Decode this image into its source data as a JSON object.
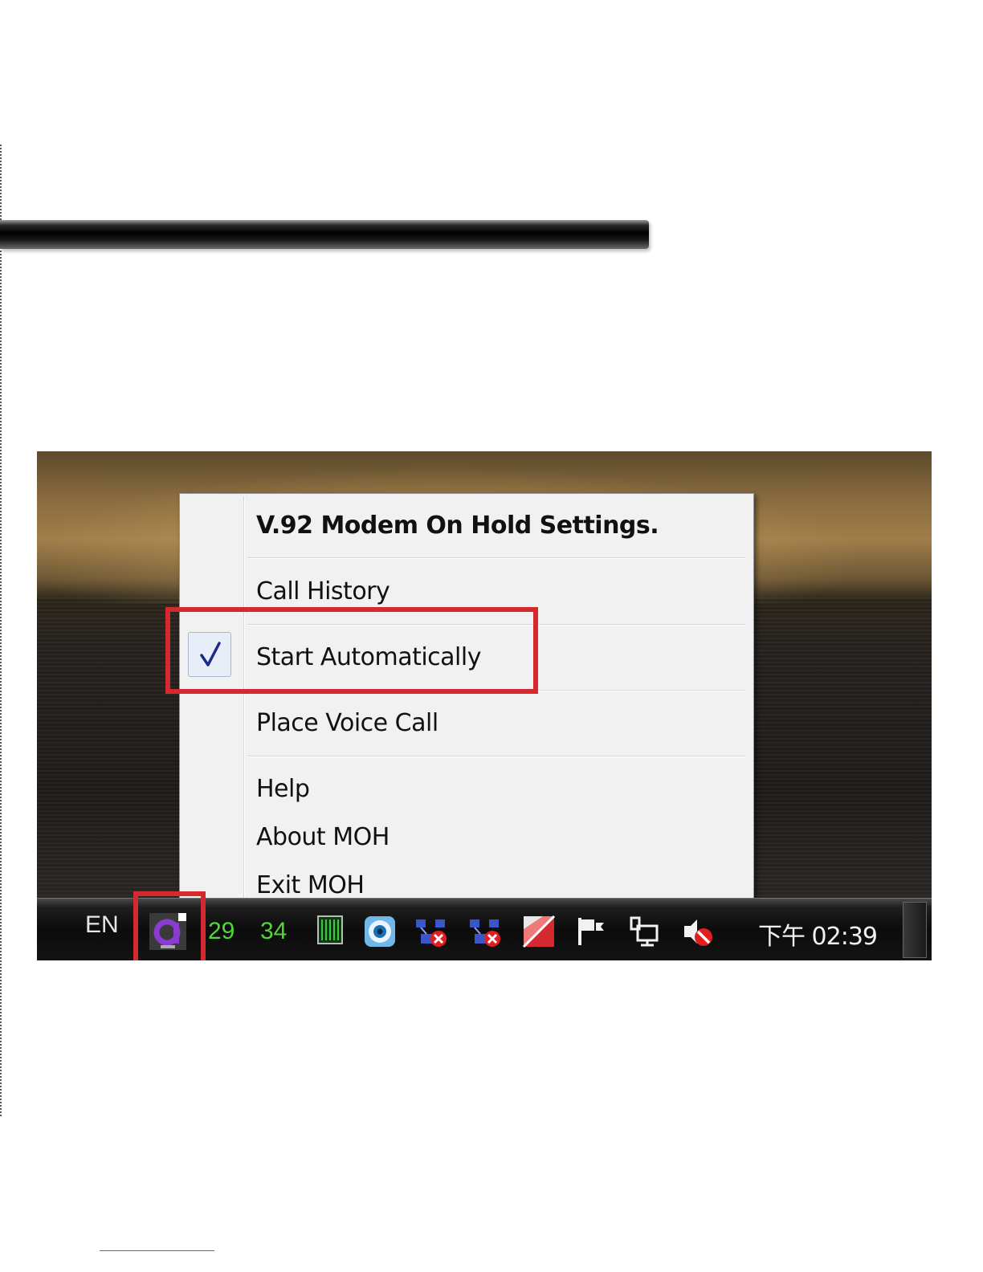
{
  "menu": {
    "items": [
      {
        "label": "V.92 Modem On Hold Settings.",
        "bold": true
      },
      {
        "label": "Call History"
      },
      {
        "label": "Start Automatically",
        "checked": true
      },
      {
        "label": "Place Voice Call"
      },
      {
        "label": "Help"
      },
      {
        "label": "About MOH"
      },
      {
        "label": "Exit MOH"
      }
    ]
  },
  "taskbar": {
    "language": "EN",
    "tray_numbers": [
      "29",
      "34"
    ],
    "tray_icons": [
      "moh-modem-icon",
      "cpu-meter-icon",
      "eye-icon",
      "network-disconnected-icon",
      "network-disconnected-icon",
      "red-app-icon",
      "action-center-flag-icon",
      "network-icon",
      "volume-muted-icon"
    ],
    "clock": "下午 02:39"
  },
  "colors": {
    "highlight": "#d42a2f",
    "tray_numbers": "#50d838",
    "menu_background": "#f1f1f1"
  }
}
